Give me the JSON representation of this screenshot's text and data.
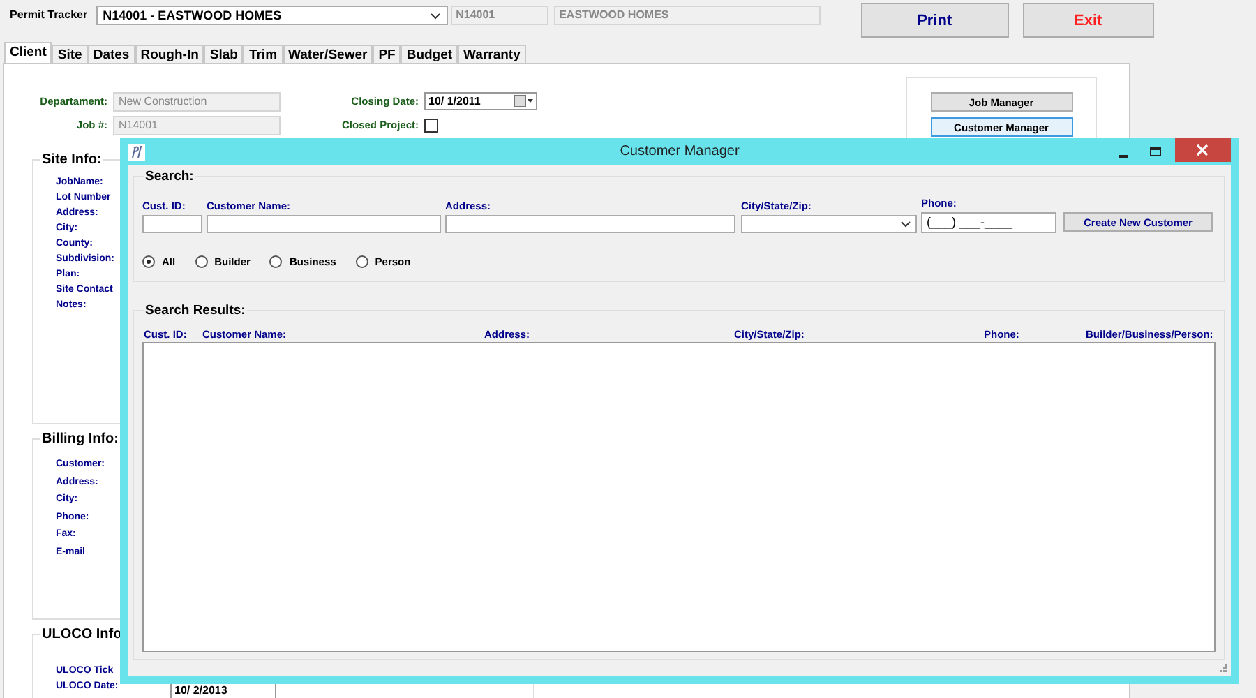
{
  "top_bar": {
    "label": "Permit Tracker",
    "job_select": "N14001 - EASTWOOD HOMES",
    "job_id": "N14001",
    "job_name": "EASTWOOD HOMES",
    "buttons": [
      {
        "label": "Print",
        "kind": "print"
      },
      {
        "label": "Exit",
        "kind": "exit"
      }
    ]
  },
  "tabs": [
    {
      "label": "Client",
      "selected": true
    },
    {
      "label": "Site",
      "selected": false
    },
    {
      "label": "Dates",
      "selected": false
    },
    {
      "label": "Rough-In",
      "selected": false
    },
    {
      "label": "Slab",
      "selected": false
    },
    {
      "label": "Trim",
      "selected": false
    },
    {
      "label": "Water/Sewer",
      "selected": false
    },
    {
      "label": "PF",
      "selected": false
    },
    {
      "label": "Budget",
      "selected": false
    },
    {
      "label": "Warranty",
      "selected": false
    }
  ],
  "client": {
    "department_label": "Departament:",
    "department": "New Construction",
    "job_label": "Job #:",
    "job": "N14001",
    "closing_label": "Closing Date:",
    "closing_date": "10/ 1/2011",
    "closed_label": "Closed Project:",
    "closed": false,
    "buttons": [
      {
        "label": "Job Manager",
        "focused": false
      },
      {
        "label": "Customer Manager",
        "focused": true
      }
    ]
  },
  "groups": [
    {
      "title": "Site Info:",
      "labels": [
        "JobName:",
        "Lot Number",
        "Address:",
        "City:",
        "County:",
        "Subdivision:",
        "Plan:",
        "Site Contact",
        "Notes:"
      ]
    },
    {
      "title": "Billing Info:",
      "labels": [
        "Customer:",
        "Address:",
        "City:",
        "Phone:",
        "Fax:",
        "E-mail"
      ]
    },
    {
      "title": "ULOCO Info",
      "labels": [
        "ULOCO Tick",
        "ULOCO Date:"
      ],
      "date": "10/ 2/2013"
    }
  ],
  "dialog": {
    "title": "Customer Manager",
    "search_title": "Search:",
    "fields": [
      {
        "label": "Cust. ID:",
        "kind": "text"
      },
      {
        "label": "Customer Name:",
        "kind": "text"
      },
      {
        "label": "Address:",
        "kind": "text"
      },
      {
        "label": "City/State/Zip:",
        "kind": "combo"
      },
      {
        "label": "Phone:",
        "kind": "masked",
        "value": "(___) ___-____"
      }
    ],
    "create_button": "Create New Customer",
    "filters": [
      {
        "label": "All",
        "selected": true
      },
      {
        "label": "Builder",
        "selected": false
      },
      {
        "label": "Business",
        "selected": false
      },
      {
        "label": "Person",
        "selected": false
      }
    ],
    "results_title": "Search Results:",
    "columns": [
      "Cust. ID:",
      "Customer Name:",
      "Address:",
      "City/State/Zip:",
      "Phone:",
      "Builder/Business/Person:"
    ]
  }
}
